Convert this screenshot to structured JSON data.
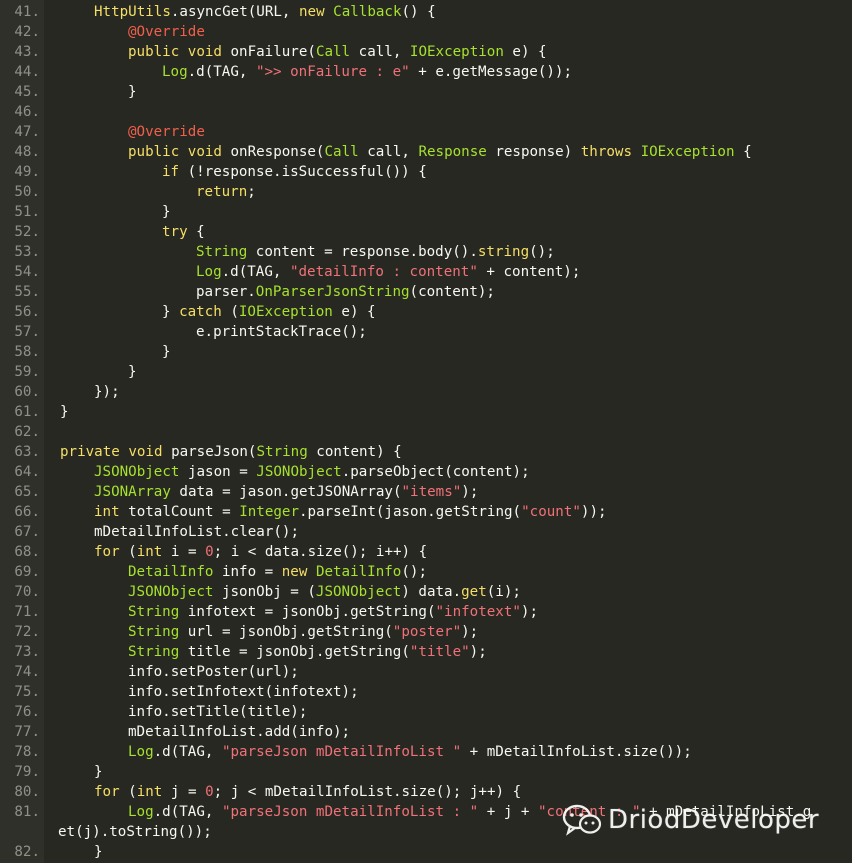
{
  "editor": {
    "language": "java",
    "theme": {
      "background": "#272822",
      "gutter": "#2f302a",
      "line_number": "#8f908a",
      "keyword": "#f5df66",
      "type": "#a6e22e",
      "string": "#f07178",
      "annotation": "#f0604c",
      "plain": "#f8f8f2"
    },
    "lines": [
      {
        "number": "41.",
        "indent": 2,
        "tokens": [
          {
            "t": "HttpUtils",
            "c": "kw"
          },
          {
            "t": ".asyncGet(URL, ",
            "c": "pl"
          },
          {
            "t": "new ",
            "c": "kw"
          },
          {
            "t": "Callback",
            "c": "ty"
          },
          {
            "t": "() {",
            "c": "pl"
          }
        ]
      },
      {
        "number": "42.",
        "indent": 3,
        "tokens": [
          {
            "t": "@Override",
            "c": "an"
          }
        ]
      },
      {
        "number": "43.",
        "indent": 3,
        "tokens": [
          {
            "t": "public ",
            "c": "kw"
          },
          {
            "t": "void ",
            "c": "kw"
          },
          {
            "t": "onFailure(",
            "c": "pl"
          },
          {
            "t": "Call",
            "c": "ty"
          },
          {
            "t": " call, ",
            "c": "pl"
          },
          {
            "t": "IOException",
            "c": "ty"
          },
          {
            "t": " e) {",
            "c": "pl"
          }
        ]
      },
      {
        "number": "44.",
        "indent": 4,
        "tokens": [
          {
            "t": "Log",
            "c": "ty"
          },
          {
            "t": ".d(TAG, ",
            "c": "pl"
          },
          {
            "t": "\">> onFailure : e\"",
            "c": "st"
          },
          {
            "t": " + e.getMessage());",
            "c": "pl"
          }
        ]
      },
      {
        "number": "45.",
        "indent": 3,
        "tokens": [
          {
            "t": "}",
            "c": "pl"
          }
        ]
      },
      {
        "number": "46.",
        "indent": 0,
        "tokens": []
      },
      {
        "number": "47.",
        "indent": 3,
        "tokens": [
          {
            "t": "@Override",
            "c": "an"
          }
        ]
      },
      {
        "number": "48.",
        "indent": 3,
        "tokens": [
          {
            "t": "public ",
            "c": "kw"
          },
          {
            "t": "void ",
            "c": "kw"
          },
          {
            "t": "onResponse(",
            "c": "pl"
          },
          {
            "t": "Call",
            "c": "ty"
          },
          {
            "t": " call, ",
            "c": "pl"
          },
          {
            "t": "Response",
            "c": "ty"
          },
          {
            "t": " response) ",
            "c": "pl"
          },
          {
            "t": "throws ",
            "c": "kw"
          },
          {
            "t": "IOException",
            "c": "ty"
          },
          {
            "t": " {",
            "c": "pl"
          }
        ]
      },
      {
        "number": "49.",
        "indent": 4,
        "tokens": [
          {
            "t": "if ",
            "c": "kw"
          },
          {
            "t": "(!response.isSuccessful()) {",
            "c": "pl"
          }
        ]
      },
      {
        "number": "50.",
        "indent": 5,
        "tokens": [
          {
            "t": "return",
            "c": "kw"
          },
          {
            "t": ";",
            "c": "pl"
          }
        ]
      },
      {
        "number": "51.",
        "indent": 4,
        "tokens": [
          {
            "t": "}",
            "c": "pl"
          }
        ]
      },
      {
        "number": "52.",
        "indent": 4,
        "tokens": [
          {
            "t": "try ",
            "c": "kw"
          },
          {
            "t": "{",
            "c": "pl"
          }
        ]
      },
      {
        "number": "53.",
        "indent": 5,
        "tokens": [
          {
            "t": "String",
            "c": "ty"
          },
          {
            "t": " content = response.body().",
            "c": "pl"
          },
          {
            "t": "string",
            "c": "kw"
          },
          {
            "t": "();",
            "c": "pl"
          }
        ]
      },
      {
        "number": "54.",
        "indent": 5,
        "tokens": [
          {
            "t": "Log",
            "c": "ty"
          },
          {
            "t": ".d(TAG, ",
            "c": "pl"
          },
          {
            "t": "\"detailInfo : content\"",
            "c": "st"
          },
          {
            "t": " + content);",
            "c": "pl"
          }
        ]
      },
      {
        "number": "55.",
        "indent": 5,
        "tokens": [
          {
            "t": "parser.",
            "c": "pl"
          },
          {
            "t": "OnParserJsonString",
            "c": "ty"
          },
          {
            "t": "(content);",
            "c": "pl"
          }
        ]
      },
      {
        "number": "56.",
        "indent": 4,
        "tokens": [
          {
            "t": "} ",
            "c": "pl"
          },
          {
            "t": "catch ",
            "c": "kw"
          },
          {
            "t": "(",
            "c": "pl"
          },
          {
            "t": "IOException",
            "c": "ty"
          },
          {
            "t": " e) {",
            "c": "pl"
          }
        ]
      },
      {
        "number": "57.",
        "indent": 5,
        "tokens": [
          {
            "t": "e.printStackTrace();",
            "c": "pl"
          }
        ]
      },
      {
        "number": "58.",
        "indent": 4,
        "tokens": [
          {
            "t": "}",
            "c": "pl"
          }
        ]
      },
      {
        "number": "59.",
        "indent": 3,
        "tokens": [
          {
            "t": "}",
            "c": "pl"
          }
        ]
      },
      {
        "number": "60.",
        "indent": 2,
        "tokens": [
          {
            "t": "});",
            "c": "pl"
          }
        ]
      },
      {
        "number": "61.",
        "indent": 1,
        "tokens": [
          {
            "t": "}",
            "c": "pl"
          }
        ]
      },
      {
        "number": "62.",
        "indent": 0,
        "tokens": []
      },
      {
        "number": "63.",
        "indent": 1,
        "tokens": [
          {
            "t": "private ",
            "c": "kw"
          },
          {
            "t": "void ",
            "c": "kw"
          },
          {
            "t": "parseJson(",
            "c": "pl"
          },
          {
            "t": "String",
            "c": "ty"
          },
          {
            "t": " content) {",
            "c": "pl"
          }
        ]
      },
      {
        "number": "64.",
        "indent": 2,
        "tokens": [
          {
            "t": "JSONObject",
            "c": "ty"
          },
          {
            "t": " jason = ",
            "c": "pl"
          },
          {
            "t": "JSONObject",
            "c": "ty"
          },
          {
            "t": ".parseObject(content);",
            "c": "pl"
          }
        ]
      },
      {
        "number": "65.",
        "indent": 2,
        "tokens": [
          {
            "t": "JSONArray",
            "c": "ty"
          },
          {
            "t": " data = jason.getJSONArray(",
            "c": "pl"
          },
          {
            "t": "\"items\"",
            "c": "st"
          },
          {
            "t": ");",
            "c": "pl"
          }
        ]
      },
      {
        "number": "66.",
        "indent": 2,
        "tokens": [
          {
            "t": "int ",
            "c": "kw"
          },
          {
            "t": "totalCount = ",
            "c": "pl"
          },
          {
            "t": "Integer",
            "c": "ty"
          },
          {
            "t": ".parseInt(jason.getString(",
            "c": "pl"
          },
          {
            "t": "\"count\"",
            "c": "st"
          },
          {
            "t": "));",
            "c": "pl"
          }
        ]
      },
      {
        "number": "67.",
        "indent": 2,
        "tokens": [
          {
            "t": "mDetailInfoList.clear();",
            "c": "pl"
          }
        ]
      },
      {
        "number": "68.",
        "indent": 2,
        "tokens": [
          {
            "t": "for ",
            "c": "kw"
          },
          {
            "t": "(",
            "c": "pl"
          },
          {
            "t": "int ",
            "c": "kw"
          },
          {
            "t": "i = ",
            "c": "pl"
          },
          {
            "t": "0",
            "c": "st"
          },
          {
            "t": "; i < data.size(); i++) {",
            "c": "pl"
          }
        ]
      },
      {
        "number": "69.",
        "indent": 3,
        "tokens": [
          {
            "t": "DetailInfo",
            "c": "ty"
          },
          {
            "t": " info = ",
            "c": "pl"
          },
          {
            "t": "new ",
            "c": "kw"
          },
          {
            "t": "DetailInfo",
            "c": "ty"
          },
          {
            "t": "();",
            "c": "pl"
          }
        ]
      },
      {
        "number": "70.",
        "indent": 3,
        "tokens": [
          {
            "t": "JSONObject",
            "c": "ty"
          },
          {
            "t": " jsonObj = (",
            "c": "pl"
          },
          {
            "t": "JSONObject",
            "c": "ty"
          },
          {
            "t": ") data.",
            "c": "pl"
          },
          {
            "t": "get",
            "c": "kw"
          },
          {
            "t": "(i);",
            "c": "pl"
          }
        ]
      },
      {
        "number": "71.",
        "indent": 3,
        "tokens": [
          {
            "t": "String",
            "c": "ty"
          },
          {
            "t": " infotext = jsonObj.getString(",
            "c": "pl"
          },
          {
            "t": "\"infotext\"",
            "c": "st"
          },
          {
            "t": ");",
            "c": "pl"
          }
        ]
      },
      {
        "number": "72.",
        "indent": 3,
        "tokens": [
          {
            "t": "String",
            "c": "ty"
          },
          {
            "t": " url = jsonObj.getString(",
            "c": "pl"
          },
          {
            "t": "\"poster\"",
            "c": "st"
          },
          {
            "t": ");",
            "c": "pl"
          }
        ]
      },
      {
        "number": "73.",
        "indent": 3,
        "tokens": [
          {
            "t": "String",
            "c": "ty"
          },
          {
            "t": " title = jsonObj.getString(",
            "c": "pl"
          },
          {
            "t": "\"title\"",
            "c": "st"
          },
          {
            "t": ");",
            "c": "pl"
          }
        ]
      },
      {
        "number": "74.",
        "indent": 3,
        "tokens": [
          {
            "t": "info.setPoster(url);",
            "c": "pl"
          }
        ]
      },
      {
        "number": "75.",
        "indent": 3,
        "tokens": [
          {
            "t": "info.setInfotext(infotext);",
            "c": "pl"
          }
        ]
      },
      {
        "number": "76.",
        "indent": 3,
        "tokens": [
          {
            "t": "info.setTitle(title);",
            "c": "pl"
          }
        ]
      },
      {
        "number": "77.",
        "indent": 3,
        "tokens": [
          {
            "t": "mDetailInfoList.add(info);",
            "c": "pl"
          }
        ]
      },
      {
        "number": "78.",
        "indent": 3,
        "tokens": [
          {
            "t": "Log",
            "c": "ty"
          },
          {
            "t": ".d(TAG, ",
            "c": "pl"
          },
          {
            "t": "\"parseJson mDetailInfoList \"",
            "c": "st"
          },
          {
            "t": " + mDetailInfoList.size());",
            "c": "pl"
          }
        ]
      },
      {
        "number": "79.",
        "indent": 2,
        "tokens": [
          {
            "t": "}",
            "c": "pl"
          }
        ]
      },
      {
        "number": "80.",
        "indent": 2,
        "tokens": [
          {
            "t": "for ",
            "c": "kw"
          },
          {
            "t": "(",
            "c": "pl"
          },
          {
            "t": "int ",
            "c": "kw"
          },
          {
            "t": "j = ",
            "c": "pl"
          },
          {
            "t": "0",
            "c": "st"
          },
          {
            "t": "; j < mDetailInfoList.size(); j++) {",
            "c": "pl"
          }
        ]
      },
      {
        "number": "81.",
        "indent": 3,
        "tokens": [
          {
            "t": "Log",
            "c": "ty"
          },
          {
            "t": ".d(TAG, ",
            "c": "pl"
          },
          {
            "t": "\"parseJson mDetailInfoList : \"",
            "c": "st"
          },
          {
            "t": " + j + ",
            "c": "pl"
          },
          {
            "t": "\"content : \"",
            "c": "st"
          },
          {
            "t": " + mDetailInfoList.g",
            "c": "pl"
          }
        ]
      },
      {
        "number": "",
        "indent": 0,
        "wrap": true,
        "tokens": [
          {
            "t": "et(j).toString());",
            "c": "pl"
          }
        ]
      },
      {
        "number": "82.",
        "indent": 2,
        "tokens": [
          {
            "t": "}",
            "c": "pl"
          }
        ]
      }
    ]
  },
  "watermark": {
    "text": "DriodDeveloper",
    "icon": "wechat-icon"
  }
}
